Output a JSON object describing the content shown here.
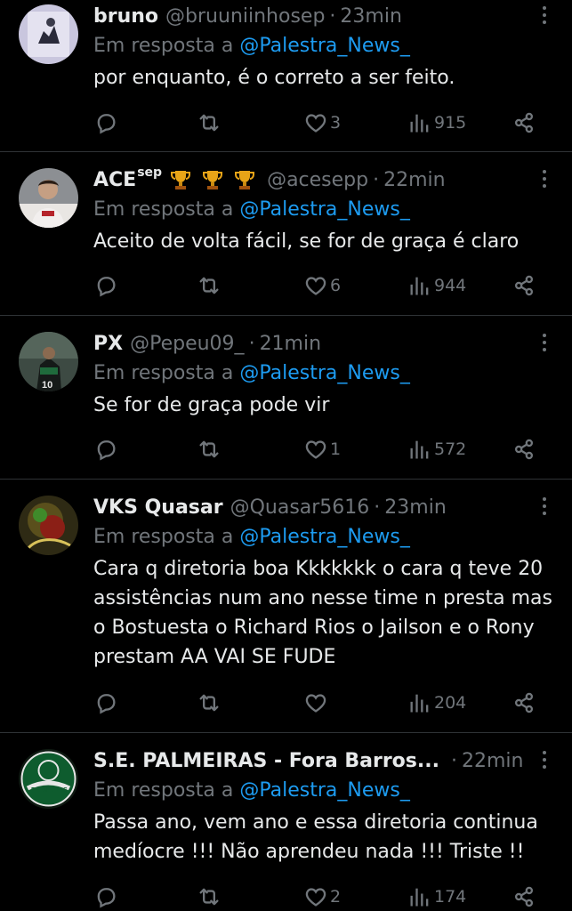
{
  "reply_prefix": "Em resposta a",
  "tweets": [
    {
      "name": "bruno",
      "sep": "",
      "handle": "@bruuniinhosep",
      "dot": "·",
      "time": "23min",
      "mention": "@Palestra_News_",
      "text": "por enquanto, é o correto a ser feito.",
      "likes": "3",
      "views": "915"
    },
    {
      "name": "ACE",
      "sep": "sep",
      "trophies": 3,
      "handle": "@acesepp",
      "dot": "·",
      "time": "22min",
      "mention": "@Palestra_News_",
      "text": "Aceito de volta fácil, se for de graça é claro",
      "likes": "6",
      "views": "944"
    },
    {
      "name": "PX",
      "sep": "",
      "handle": "@Pepeu09_",
      "dot": "·",
      "time": "21min",
      "mention": "@Palestra_News_",
      "text": "Se for de graça pode vir",
      "likes": "1",
      "views": "572"
    },
    {
      "name": "VKS Quasar",
      "sep": "",
      "handle": "@Quasar5616",
      "dot": "·",
      "time": "23min",
      "mention": "@Palestra_News_",
      "text": "Cara q diretoria boa Kkkkkkk o cara q teve 20 assistências num ano nesse time n presta mas o Bostuesta o Richard Rios o Jailson e o Rony prestam AA VAI SE FUDE",
      "likes": "",
      "views": "204"
    },
    {
      "name": "S.E. PALMEIRAS - Fora Barros...",
      "sep": "",
      "handle": "",
      "dot": "·",
      "time": "22min",
      "mention": "@Palestra_News_",
      "text": "Passa ano, vem ano e essa diretoria continua medíocre !!! Não aprendeu nada !!! Triste !!",
      "likes": "2",
      "views": "174"
    }
  ],
  "colors": {
    "background": "#000000",
    "text": "#e7e9ea",
    "muted": "#71767b",
    "link": "#1d9bf0",
    "divider": "#2f3336"
  },
  "icons": [
    "reply-icon",
    "retweet-icon",
    "like-icon",
    "views-icon",
    "share-icon",
    "more-icon",
    "trophy-icon"
  ]
}
